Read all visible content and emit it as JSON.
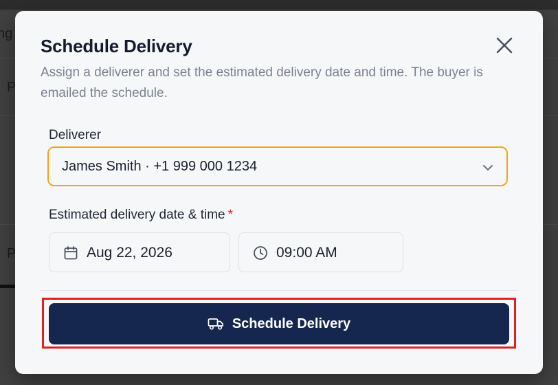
{
  "background": {
    "fragments": [
      "ng",
      "P",
      "P"
    ]
  },
  "modal": {
    "title": "Schedule Delivery",
    "description": "Assign a deliverer and set the estimated delivery date and time. The buyer is emailed the schedule.",
    "close_icon": "close-icon",
    "deliverer": {
      "label": "Deliverer",
      "selected_value": "James Smith · +1 999 000 1234",
      "icon": "chevron-down-icon"
    },
    "schedule": {
      "label": "Estimated delivery date & time",
      "required_marker": "*",
      "date_value": "Aug 22, 2026",
      "date_icon": "calendar-icon",
      "time_value": "09:00 AM",
      "time_icon": "clock-icon"
    },
    "submit": {
      "label": "Schedule Delivery",
      "icon": "truck-icon"
    }
  },
  "colors": {
    "accent_focus": "#f0a51c",
    "primary_button": "#15264f",
    "required": "#e02424",
    "highlight": "#e02020"
  }
}
